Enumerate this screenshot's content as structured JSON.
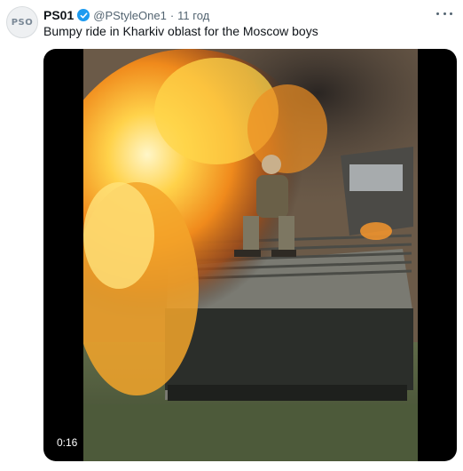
{
  "tweet": {
    "avatar_text": "PSO",
    "display_name": "PS01",
    "verified_icon": "verified-badge-icon",
    "handle": "@PStyleOne1",
    "separator": "·",
    "time": "11 год",
    "text": "Bumpy ride in Kharkiv oblast for the Moscow boys",
    "more_icon": "more-options-icon"
  },
  "video": {
    "duration": "0:16",
    "description_icon": "video-frame"
  },
  "colors": {
    "verified": "#1d9bf0",
    "name": "#0f1419",
    "secondary": "#536471"
  }
}
